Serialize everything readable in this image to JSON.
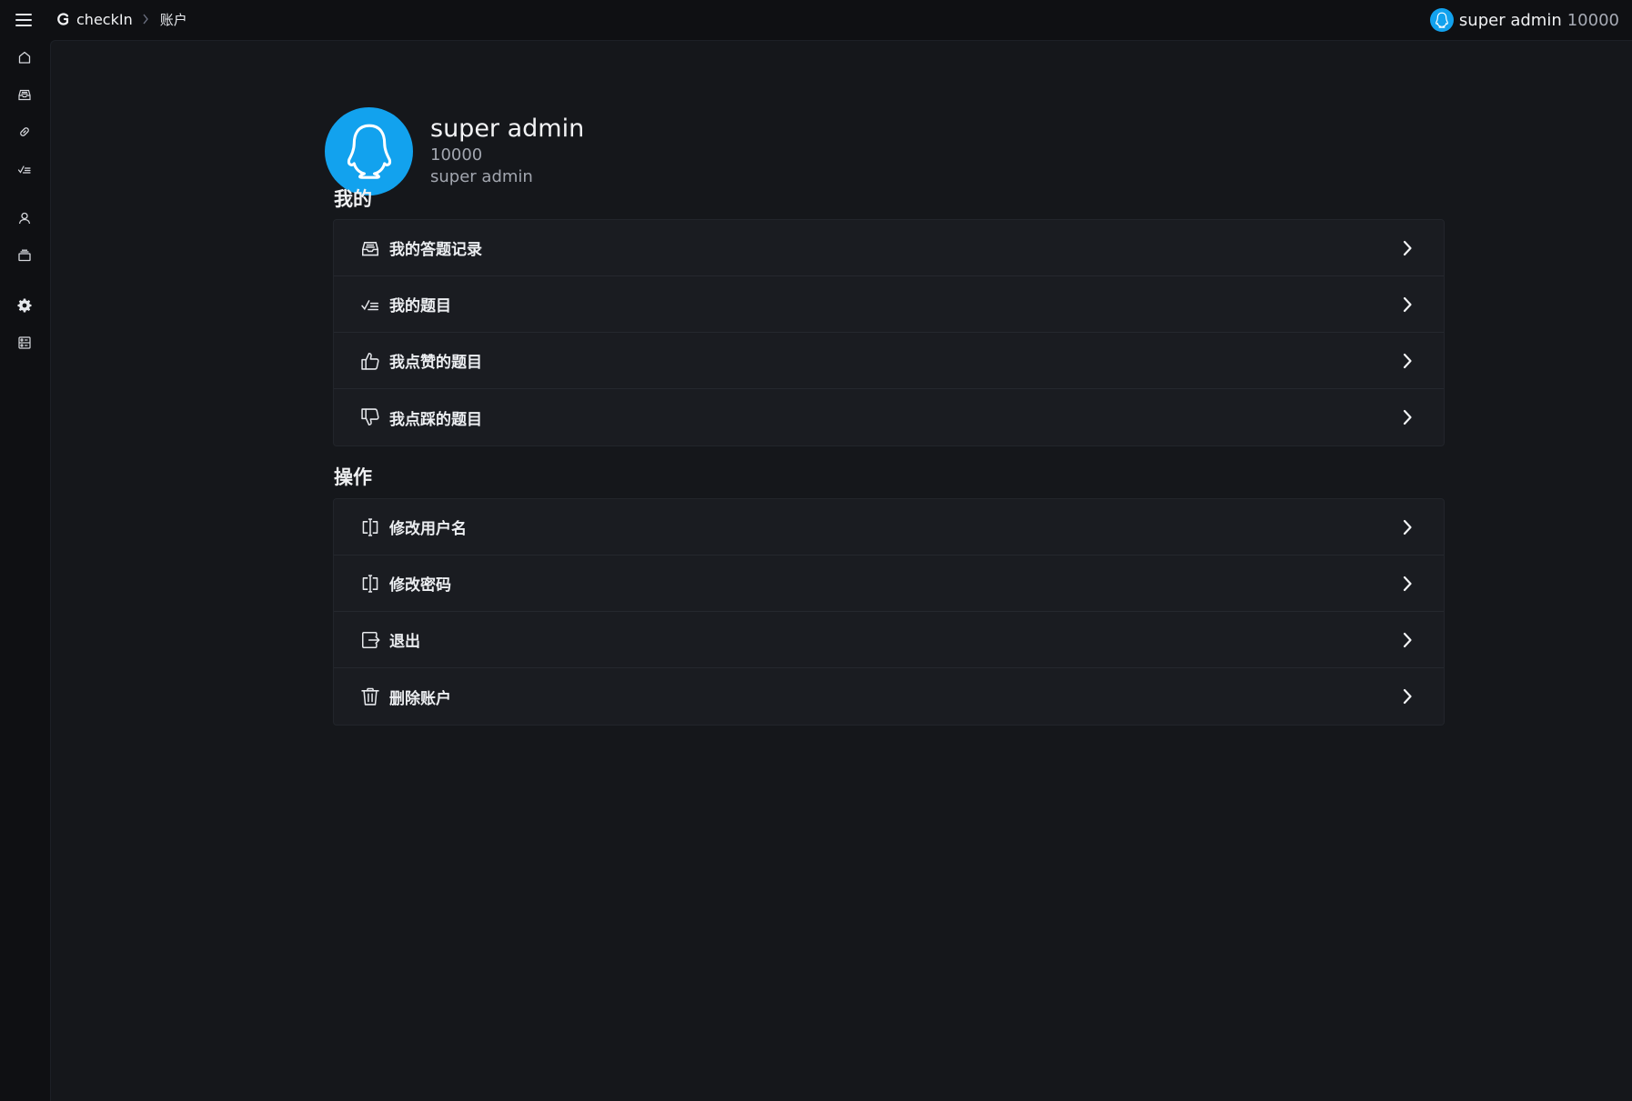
{
  "app": {
    "brand": "checkIn",
    "breadcrumb_current": "账户"
  },
  "top_user": {
    "name": "super admin",
    "id": "10000"
  },
  "sidebar": {
    "items": [
      {
        "icon": "home-icon"
      },
      {
        "icon": "inbox-icon"
      },
      {
        "icon": "link-icon"
      },
      {
        "icon": "checklist-icon"
      },
      {
        "icon": "user-icon"
      },
      {
        "icon": "archive-icon"
      },
      {
        "icon": "gear-icon"
      },
      {
        "icon": "panel-icon"
      }
    ]
  },
  "profile": {
    "name": "super admin",
    "id": "10000",
    "role": "super admin"
  },
  "sections": {
    "mine": {
      "title": "我的",
      "items": [
        {
          "label": "我的答题记录",
          "icon": "inbox-icon"
        },
        {
          "label": "我的题目",
          "icon": "checklist-icon"
        },
        {
          "label": "我点赞的题目",
          "icon": "thumbs-up-icon"
        },
        {
          "label": "我点踩的题目",
          "icon": "thumbs-down-icon"
        }
      ]
    },
    "actions": {
      "title": "操作",
      "items": [
        {
          "label": "修改用户名",
          "icon": "edit-box-icon"
        },
        {
          "label": "修改密码",
          "icon": "edit-box-icon"
        },
        {
          "label": "退出",
          "icon": "logout-icon"
        },
        {
          "label": "删除账户",
          "icon": "trash-icon"
        }
      ]
    }
  },
  "colors": {
    "background": "#0f1013",
    "panel": "#15171b",
    "card": "#1a1c21",
    "accent": "#12a2ee"
  }
}
